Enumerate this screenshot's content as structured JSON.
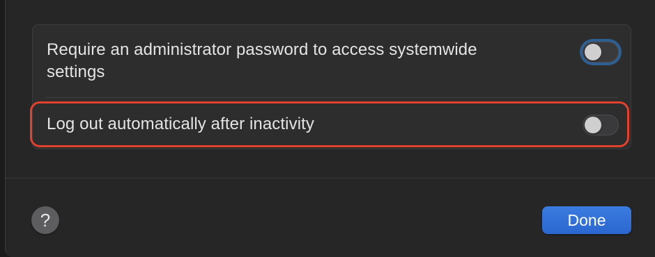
{
  "settings": {
    "rows": [
      {
        "label": "Require an administrator password to access systemwide settings",
        "enabled": false,
        "focused": true
      },
      {
        "label": "Log out automatically after inactivity",
        "enabled": false,
        "highlighted": true
      }
    ]
  },
  "footer": {
    "help_label": "?",
    "done_label": "Done"
  },
  "colors": {
    "accent": "#2f6fd4",
    "highlight": "#e2412e",
    "focus_ring": "#2e5f93"
  }
}
